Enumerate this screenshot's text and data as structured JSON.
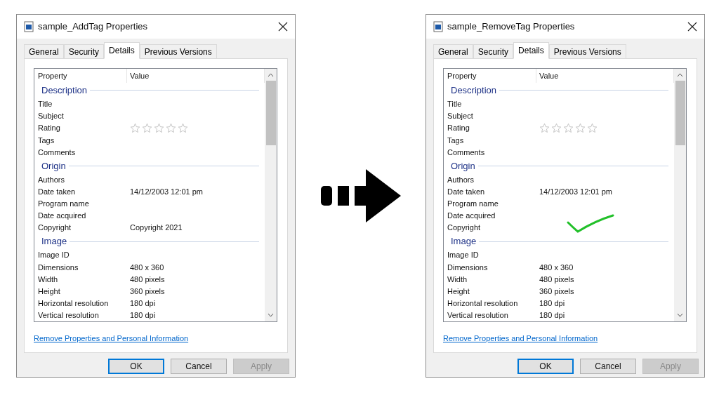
{
  "dialogs": [
    {
      "title": "sample_AddTag Properties",
      "checkmark": false,
      "tabs": [
        {
          "label": "General",
          "selected": false
        },
        {
          "label": "Security",
          "selected": false
        },
        {
          "label": "Details",
          "selected": true
        },
        {
          "label": "Previous Versions",
          "selected": false
        }
      ],
      "columns": [
        "Property",
        "Value"
      ],
      "groups": [
        {
          "name": "Description",
          "rows": [
            {
              "kind": "text",
              "property": "Title"
            },
            {
              "kind": "text",
              "property": "Subject"
            },
            {
              "kind": "stars",
              "property": "Rating",
              "stars": 0
            },
            {
              "kind": "text",
              "property": "Tags"
            },
            {
              "kind": "text",
              "property": "Comments"
            }
          ]
        },
        {
          "name": "Origin",
          "rows": [
            {
              "kind": "text",
              "property": "Authors"
            },
            {
              "kind": "text",
              "property": "Date taken",
              "value": "14/12/2003 12:01 pm"
            },
            {
              "kind": "text",
              "property": "Program name"
            },
            {
              "kind": "text",
              "property": "Date acquired"
            },
            {
              "kind": "text",
              "property": "Copyright",
              "value": "Copyright 2021"
            }
          ]
        },
        {
          "name": "Image",
          "rows": [
            {
              "kind": "text",
              "property": "Image ID"
            },
            {
              "kind": "text",
              "property": "Dimensions",
              "value": "480 x 360"
            },
            {
              "kind": "text",
              "property": "Width",
              "value": "480 pixels"
            },
            {
              "kind": "text",
              "property": "Height",
              "value": "360 pixels"
            },
            {
              "kind": "text",
              "property": "Horizontal resolution",
              "value": "180 dpi"
            },
            {
              "kind": "text",
              "property": "Vertical resolution",
              "value": "180 dpi"
            }
          ]
        }
      ],
      "link": "Remove Properties and Personal Information",
      "buttons": [
        {
          "label": "OK",
          "kind": "default"
        },
        {
          "label": "Cancel",
          "kind": "normal"
        },
        {
          "label": "Apply",
          "kind": "disabled"
        }
      ]
    },
    {
      "title": "sample_RemoveTag Properties",
      "checkmark": true,
      "tabs": [
        {
          "label": "General",
          "selected": false
        },
        {
          "label": "Security",
          "selected": false
        },
        {
          "label": "Details",
          "selected": true
        },
        {
          "label": "Previous Versions",
          "selected": false
        }
      ],
      "columns": [
        "Property",
        "Value"
      ],
      "groups": [
        {
          "name": "Description",
          "rows": [
            {
              "kind": "text",
              "property": "Title"
            },
            {
              "kind": "text",
              "property": "Subject"
            },
            {
              "kind": "stars",
              "property": "Rating",
              "stars": 0
            },
            {
              "kind": "text",
              "property": "Tags"
            },
            {
              "kind": "text",
              "property": "Comments"
            }
          ]
        },
        {
          "name": "Origin",
          "rows": [
            {
              "kind": "text",
              "property": "Authors"
            },
            {
              "kind": "text",
              "property": "Date taken",
              "value": "14/12/2003 12:01 pm"
            },
            {
              "kind": "text",
              "property": "Program name"
            },
            {
              "kind": "text",
              "property": "Date acquired"
            },
            {
              "kind": "text",
              "property": "Copyright"
            }
          ]
        },
        {
          "name": "Image",
          "rows": [
            {
              "kind": "text",
              "property": "Image ID"
            },
            {
              "kind": "text",
              "property": "Dimensions",
              "value": "480 x 360"
            },
            {
              "kind": "text",
              "property": "Width",
              "value": "480 pixels"
            },
            {
              "kind": "text",
              "property": "Height",
              "value": "360 pixels"
            },
            {
              "kind": "text",
              "property": "Horizontal resolution",
              "value": "180 dpi"
            },
            {
              "kind": "text",
              "property": "Vertical resolution",
              "value": "180 dpi"
            }
          ]
        }
      ],
      "link": "Remove Properties and Personal Information",
      "buttons": [
        {
          "label": "OK",
          "kind": "default"
        },
        {
          "label": "Cancel",
          "kind": "normal"
        },
        {
          "label": "Apply",
          "kind": "disabled"
        }
      ]
    }
  ]
}
